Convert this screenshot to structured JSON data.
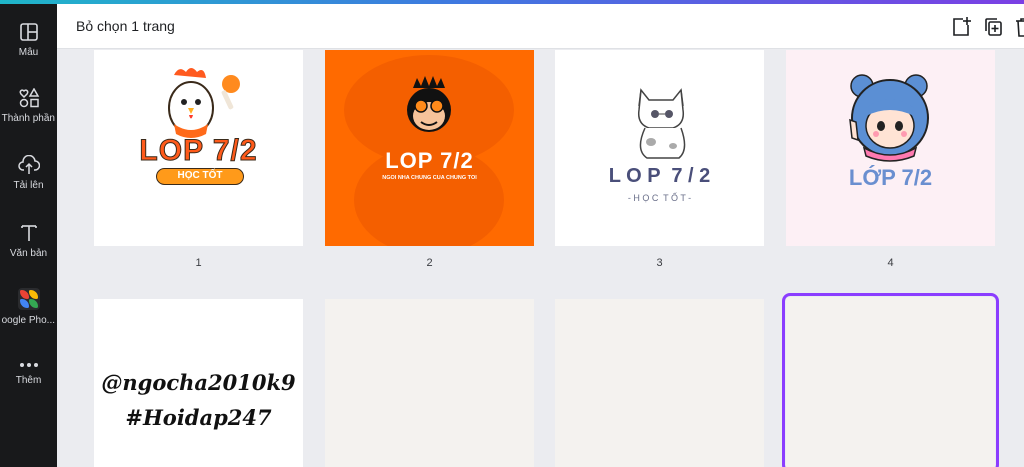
{
  "sidebar": {
    "items": [
      {
        "label": "Mẫu",
        "icon": "templates-icon"
      },
      {
        "label": "Thành phần",
        "icon": "elements-icon"
      },
      {
        "label": "Tải lên",
        "icon": "upload-icon"
      },
      {
        "label": "Văn bản",
        "icon": "text-icon"
      },
      {
        "label": "oogle Pho...",
        "icon": "google-photos-icon"
      },
      {
        "label": "Thêm",
        "icon": "more-icon"
      }
    ]
  },
  "header": {
    "title": "Bỏ chọn 1 trang",
    "actions": [
      "add-page-icon",
      "duplicate-page-icon",
      "delete-page-icon"
    ]
  },
  "pages": [
    {
      "number": "1",
      "bg": "#ffffff",
      "title": "LOP 7/2",
      "subtitle": "HỌC TỐT"
    },
    {
      "number": "2",
      "bg": "#ff6a00",
      "title": "LOP 7/2",
      "subtitle": "NGOI NHA CHUNG CUA CHUNG TOI"
    },
    {
      "number": "3",
      "bg": "#ffffff",
      "title": "L O P  7 / 2",
      "subtitle": "- H Ọ C  T Ố T -"
    },
    {
      "number": "4",
      "bg": "#fdf0f5",
      "title": "LỚP 7/2",
      "subtitle": ""
    },
    {
      "number": "",
      "bg": "#ffffff",
      "line1": "@ngocha2010k9",
      "line2": "#Hoidap247"
    },
    {
      "number": "",
      "bg": "#f4f2ef"
    },
    {
      "number": "",
      "bg": "#f4f2ef"
    },
    {
      "number": "",
      "bg": "#f4f2ef",
      "selected": true
    }
  ],
  "colors": {
    "accent": "#8b3dff",
    "sidebar": "#18191b",
    "orange": "#ff6a00",
    "blue_title": "#6a8fd0"
  }
}
